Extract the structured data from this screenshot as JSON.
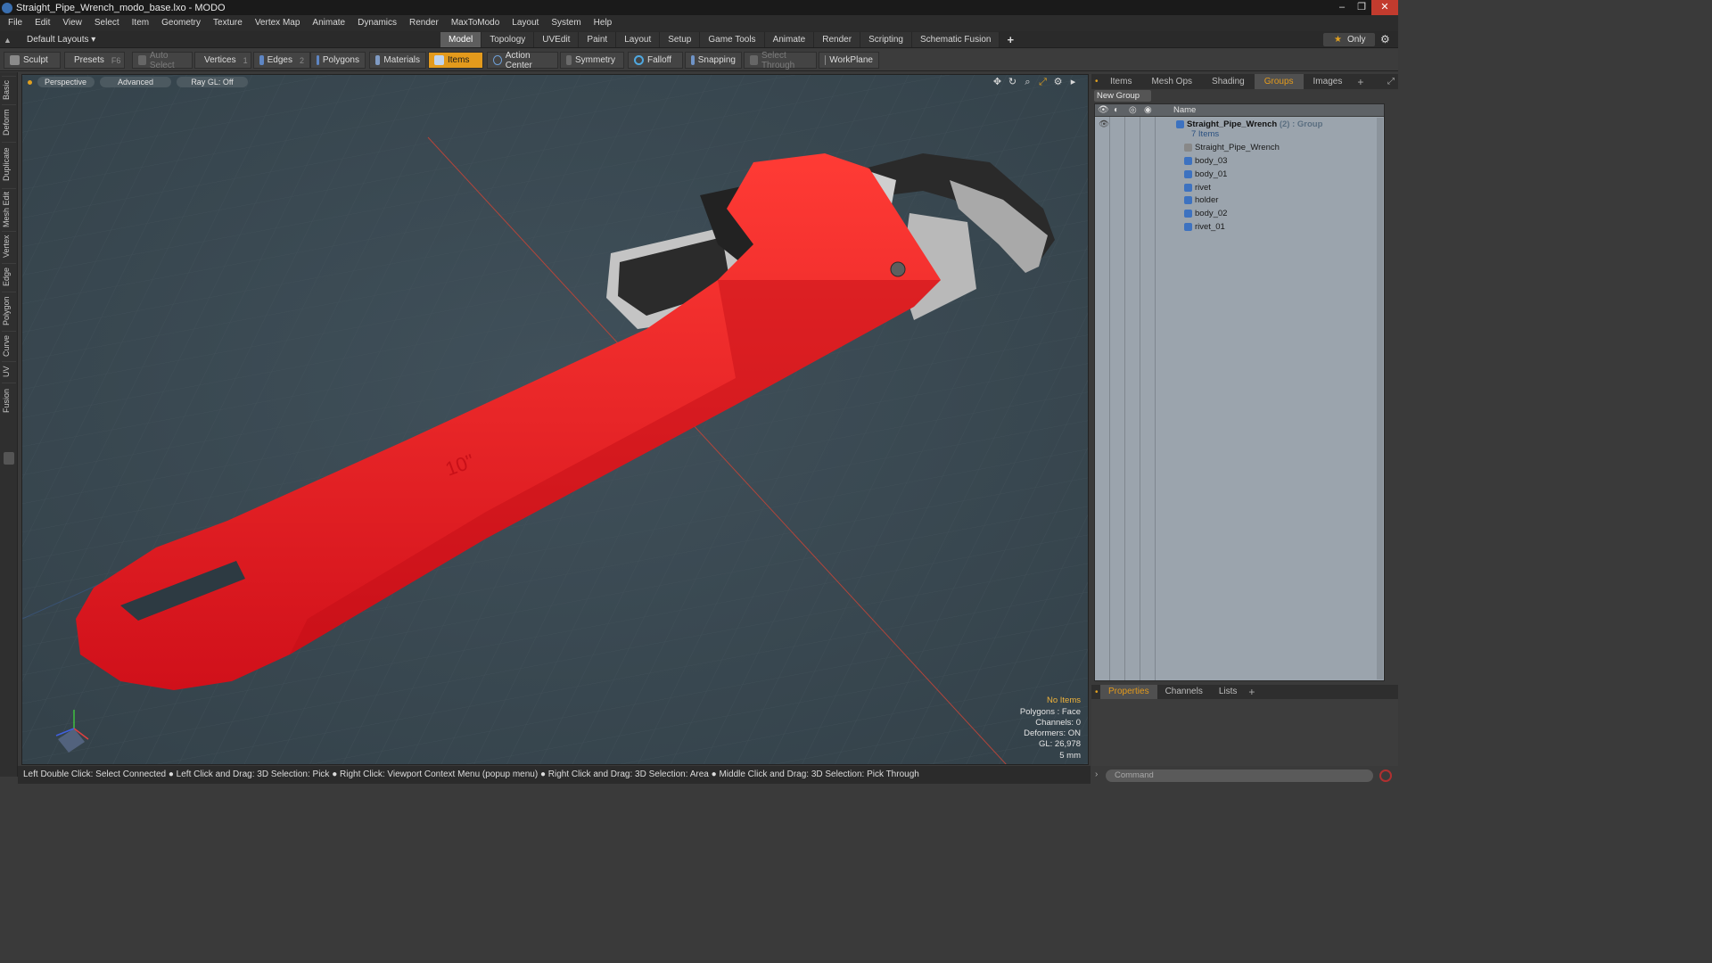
{
  "window": {
    "title": "Straight_Pipe_Wrench_modo_base.lxo - MODO",
    "controls": [
      "–",
      "❐",
      "✕"
    ]
  },
  "menu": [
    "File",
    "Edit",
    "View",
    "Select",
    "Item",
    "Geometry",
    "Texture",
    "Vertex Map",
    "Animate",
    "Dynamics",
    "Render",
    "MaxToModo",
    "Layout",
    "System",
    "Help"
  ],
  "layout_select": "Default Layouts ▾",
  "mode_tabs": [
    {
      "label": "Model",
      "active": true
    },
    {
      "label": "Topology"
    },
    {
      "label": "UVEdit"
    },
    {
      "label": "Paint"
    },
    {
      "label": "Layout"
    },
    {
      "label": "Setup"
    },
    {
      "label": "Game Tools"
    },
    {
      "label": "Animate"
    },
    {
      "label": "Render"
    },
    {
      "label": "Scripting"
    },
    {
      "label": "Schematic Fusion"
    }
  ],
  "mode_tabs_plus": "+",
  "only_button": "Only",
  "toolbar": {
    "sculpt": "Sculpt",
    "presets": "Presets",
    "presets_key": "F6",
    "auto_select": "Auto Select",
    "vertices": "Vertices",
    "vertices_count": "1",
    "edges": "Edges",
    "edges_count": "2",
    "polygons": "Polygons",
    "materials": "Materials",
    "items": "Items",
    "action_center": "Action Center",
    "symmetry": "Symmetry",
    "falloff": "Falloff",
    "snapping": "Snapping",
    "select_through": "Select Through",
    "workplane": "WorkPlane"
  },
  "left_tabs": [
    "Basic",
    "Deform",
    "Duplicate",
    "Mesh Edit",
    "Vertex",
    "Edge",
    "Polygon",
    "Curve",
    "UV",
    "Fusion"
  ],
  "viewport": {
    "view": "Perspective",
    "shading": "Advanced",
    "raygl": "Ray GL: Off",
    "stats": {
      "items": "No Items",
      "polygons": "Polygons : Face",
      "channels": "Channels: 0",
      "deformers": "Deformers: ON",
      "gl": "GL: 26,978",
      "scale": "5 mm"
    },
    "handle_label": "10\""
  },
  "status_bar": "Left Double Click: Select Connected ● Left Click and Drag: 3D Selection: Pick ● Right Click: Viewport Context Menu (popup menu) ● Right Click and Drag: 3D Selection: Area ● Middle Click and Drag: 3D Selection: Pick Through",
  "right_panel": {
    "tabs": [
      {
        "label": "Items"
      },
      {
        "label": "Mesh Ops"
      },
      {
        "label": "Shading"
      },
      {
        "label": "Groups",
        "active": true
      },
      {
        "label": "Images"
      }
    ],
    "new_group": "New Group",
    "name_header": "Name",
    "group": {
      "name": "Straight_Pipe_Wrench",
      "count": "(2)",
      "type": ": Group",
      "items_label": "7 Items"
    },
    "items": [
      "Straight_Pipe_Wrench",
      "body_03",
      "body_01",
      "rivet",
      "holder",
      "body_02",
      "rivet_01"
    ],
    "bottom_tabs": [
      {
        "label": "Properties",
        "active": true
      },
      {
        "label": "Channels"
      },
      {
        "label": "Lists"
      }
    ],
    "command_placeholder": "Command"
  },
  "colors": {
    "accent": "#e39a1c",
    "wrench_red": "#e0161c",
    "viewport_bg": "#3c4a52"
  }
}
